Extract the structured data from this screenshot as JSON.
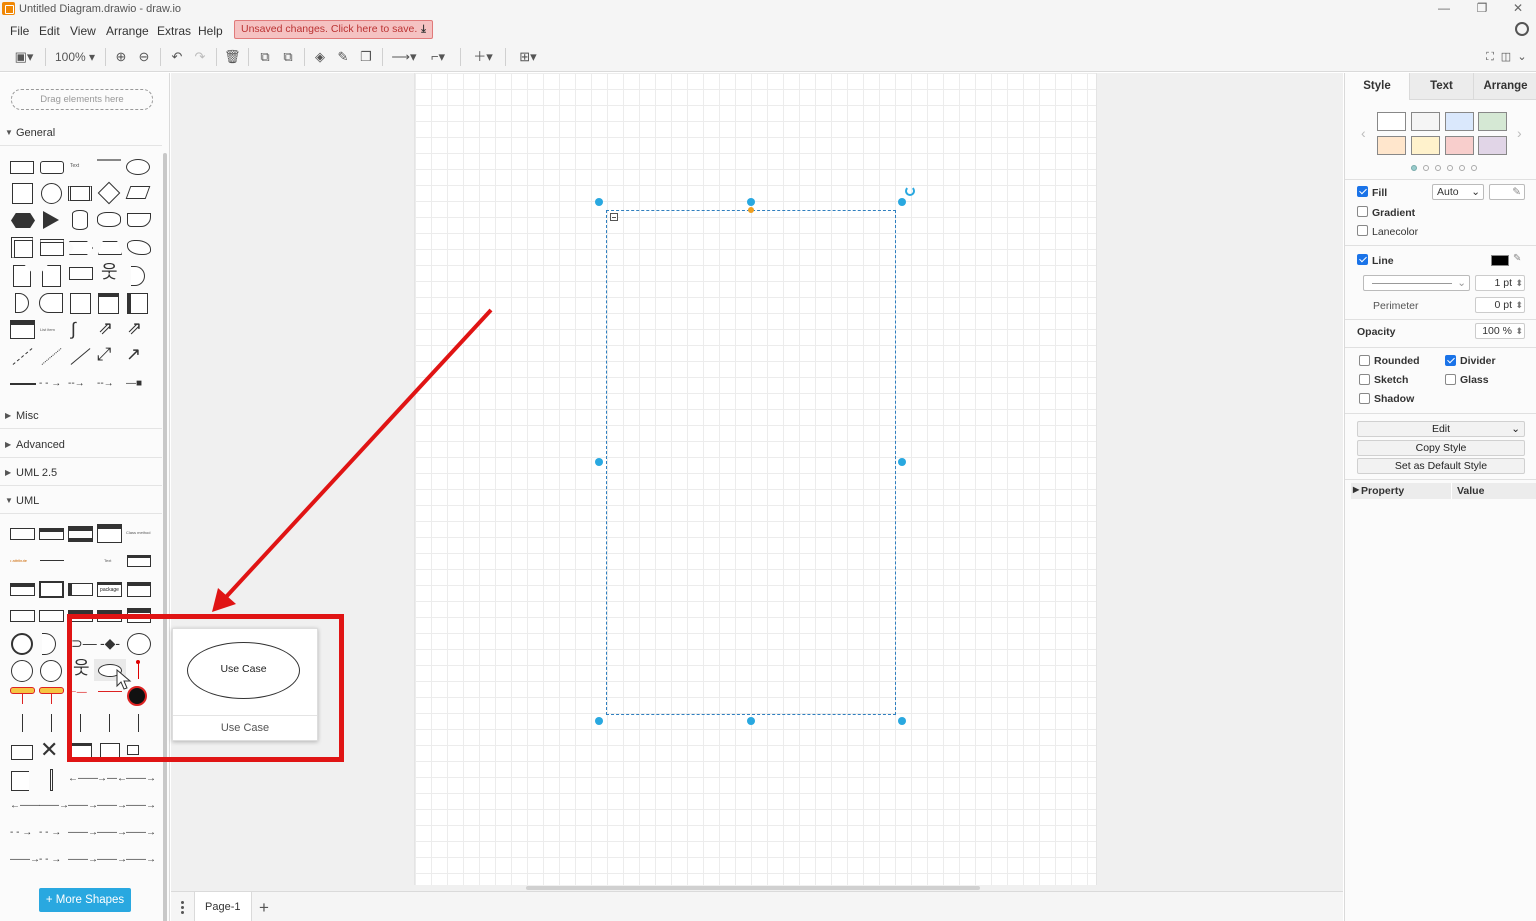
{
  "titlebar": {
    "title": "Untitled Diagram.drawio - draw.io",
    "minimize": "—",
    "maximize": "❐",
    "close": "✕"
  },
  "menubar": {
    "items": [
      "File",
      "Edit",
      "View",
      "Arrange",
      "Extras",
      "Help"
    ],
    "unsaved_notice": "Unsaved changes. Click here to save."
  },
  "toolbar": {
    "zoom": "100%"
  },
  "sidebar": {
    "dropzone": "Drag elements here",
    "sections": [
      "General",
      "Misc",
      "Advanced",
      "UML 2.5",
      "UML"
    ],
    "more_shapes": "+ More Shapes"
  },
  "tooltip": {
    "shape_label": "Use Case",
    "caption": "Use Case"
  },
  "bottombar": {
    "page_tab": "Page-1 ⌃",
    "add_page": "+"
  },
  "rightpanel": {
    "tabs": [
      "Style",
      "Text",
      "Arrange"
    ],
    "swatch_colors": [
      "#ffffff",
      "#f5f5f5",
      "#dae8fc",
      "#d5e8d4",
      "#ffe6cc",
      "#fff2cc",
      "#f8cecc",
      "#e1d5e7"
    ],
    "fill": {
      "label": "Fill",
      "mode": "Auto",
      "checked": true
    },
    "gradient": {
      "label": "Gradient"
    },
    "lanecolor": {
      "label": "Lanecolor"
    },
    "line": {
      "label": "Line",
      "width": "1 pt",
      "checked": true
    },
    "perimeter": {
      "label": "Perimeter",
      "value": "0 pt"
    },
    "opacity": {
      "label": "Opacity",
      "value": "100 %"
    },
    "options": [
      {
        "label": "Rounded",
        "checked": false
      },
      {
        "label": "Divider",
        "checked": true
      },
      {
        "label": "Sketch",
        "checked": false
      },
      {
        "label": "Glass",
        "checked": false
      },
      {
        "label": "Shadow",
        "checked": false
      }
    ],
    "edit_label": "Edit",
    "copy_style": "Copy Style",
    "set_default": "Set as Default Style",
    "property_header": "Property",
    "value_header": "Value"
  },
  "colors": {
    "accent": "#29a8e0",
    "annotation_red": "#e01414",
    "unsaved_bg": "#f5c2c2"
  }
}
